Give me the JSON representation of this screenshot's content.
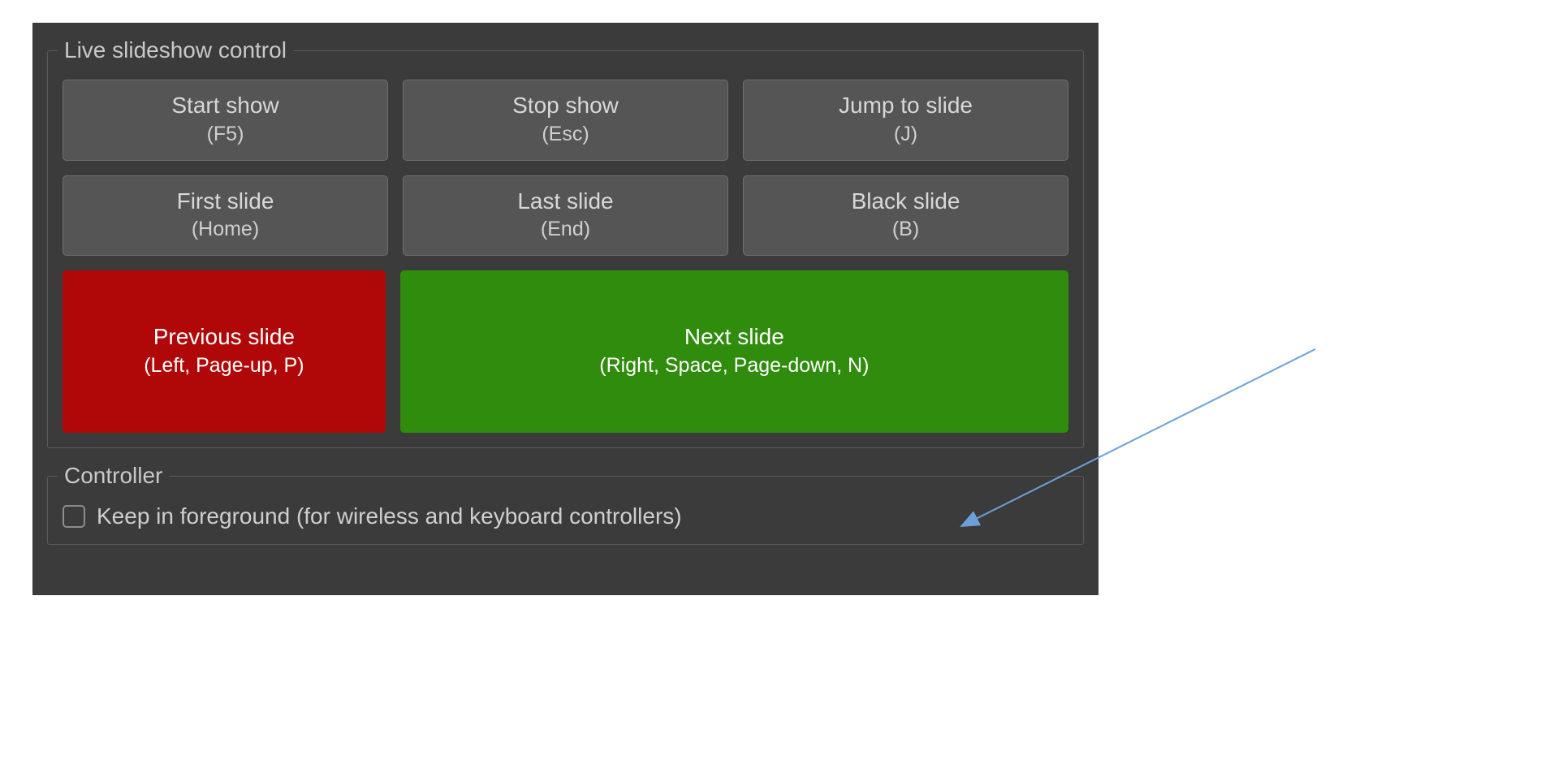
{
  "groups": {
    "slideshow": {
      "legend": "Live slideshow control",
      "buttons": {
        "start": {
          "label": "Start show",
          "shortcut": "(F5)"
        },
        "stop": {
          "label": "Stop show",
          "shortcut": "(Esc)"
        },
        "jump": {
          "label": "Jump to slide",
          "shortcut": "(J)"
        },
        "first": {
          "label": "First slide",
          "shortcut": "(Home)"
        },
        "last": {
          "label": "Last slide",
          "shortcut": "(End)"
        },
        "black": {
          "label": "Black slide",
          "shortcut": "(B)"
        },
        "prev": {
          "label": "Previous slide",
          "shortcut": "(Left, Page-up, P)"
        },
        "next": {
          "label": "Next slide",
          "shortcut": "(Right, Space, Page-down, N)"
        }
      }
    },
    "controller": {
      "legend": "Controller",
      "keep_foreground": {
        "label": "Keep in foreground (for wireless and keyboard controllers)",
        "checked": false
      }
    }
  },
  "colors": {
    "panel_bg": "#3b3b3b",
    "button_bg": "#555555",
    "button_red": "#b00808",
    "button_green": "#2f8c0c",
    "text": "#d8d8d8",
    "arrow": "#6ca0d8"
  }
}
